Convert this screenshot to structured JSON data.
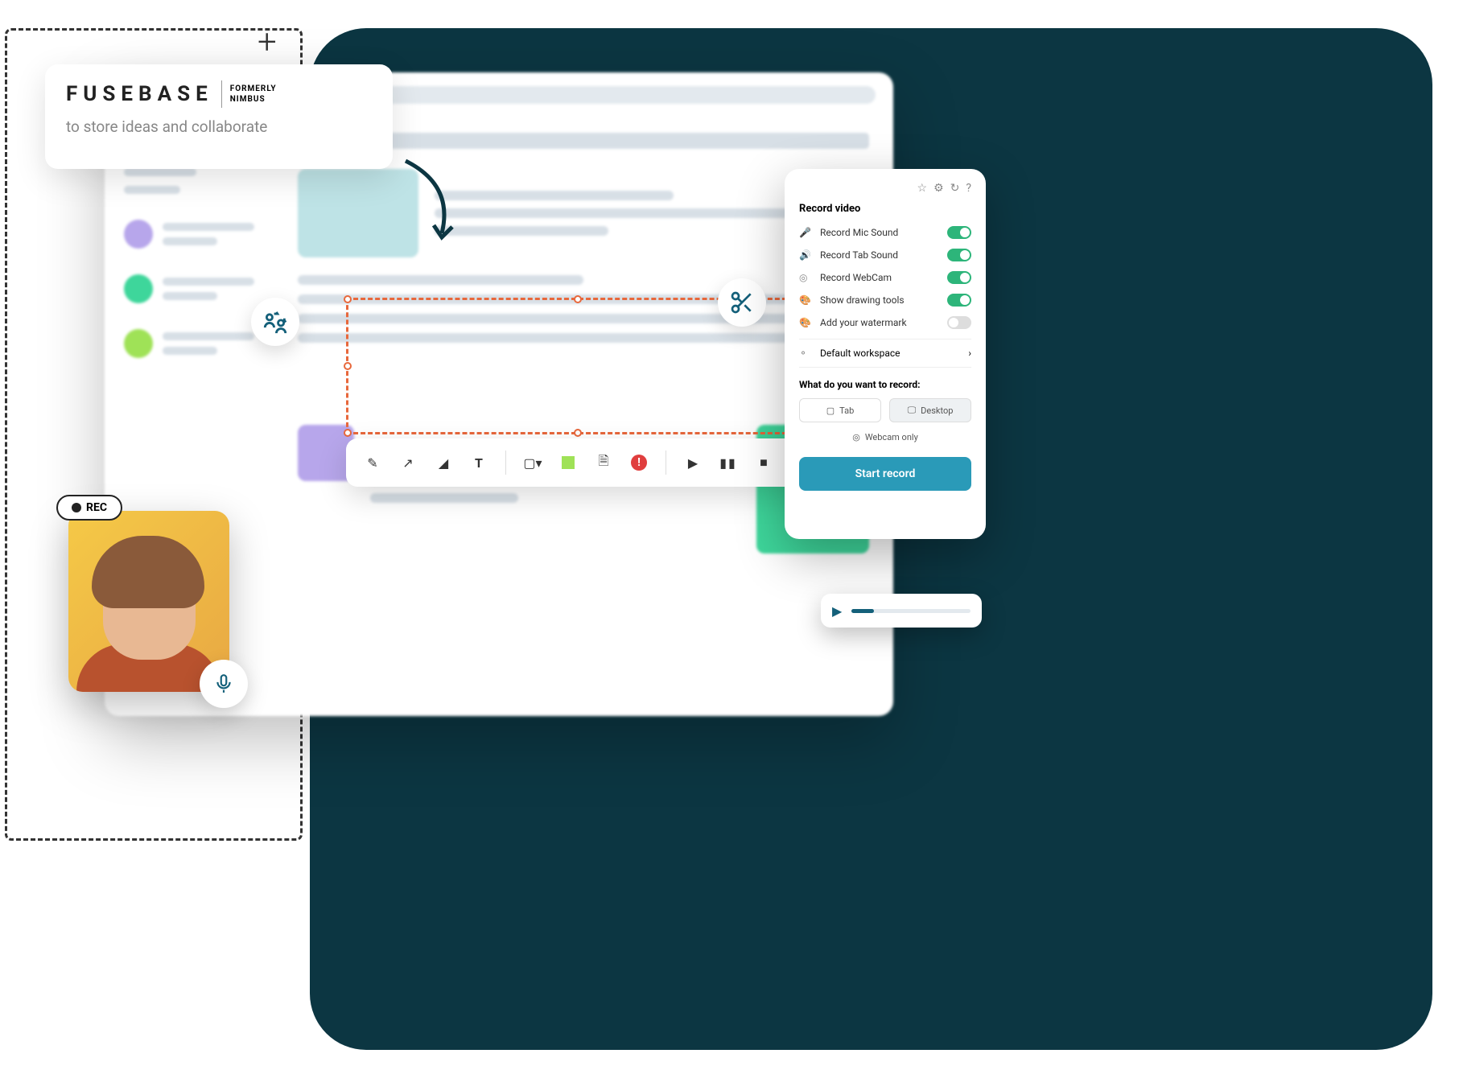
{
  "logo": {
    "brand": "FUSEBASE",
    "sub1": "FORMERLY",
    "sub2": "NIMBUS"
  },
  "tagline": "to store ideas and collaborate",
  "rec_label": "REC",
  "panel": {
    "title": "Record video",
    "options": [
      {
        "label": "Record Mic Sound",
        "on": true
      },
      {
        "label": "Record Tab Sound",
        "on": true
      },
      {
        "label": "Record WebCam",
        "on": true
      },
      {
        "label": "Show drawing tools",
        "on": true
      },
      {
        "label": "Add your watermark",
        "on": false
      }
    ],
    "workspace": "Default workspace",
    "question": "What do you want to record:",
    "tab": "Tab",
    "desktop": "Desktop",
    "webcam_only": "Webcam only",
    "start": "Start record"
  },
  "colors": {
    "sidebar_dots": [
      "#B7A6EB",
      "#3ED69B",
      "#9FE257"
    ],
    "thumbs": [
      "#BEE3E6",
      "#B7A6EB",
      "#3ED69B"
    ]
  }
}
